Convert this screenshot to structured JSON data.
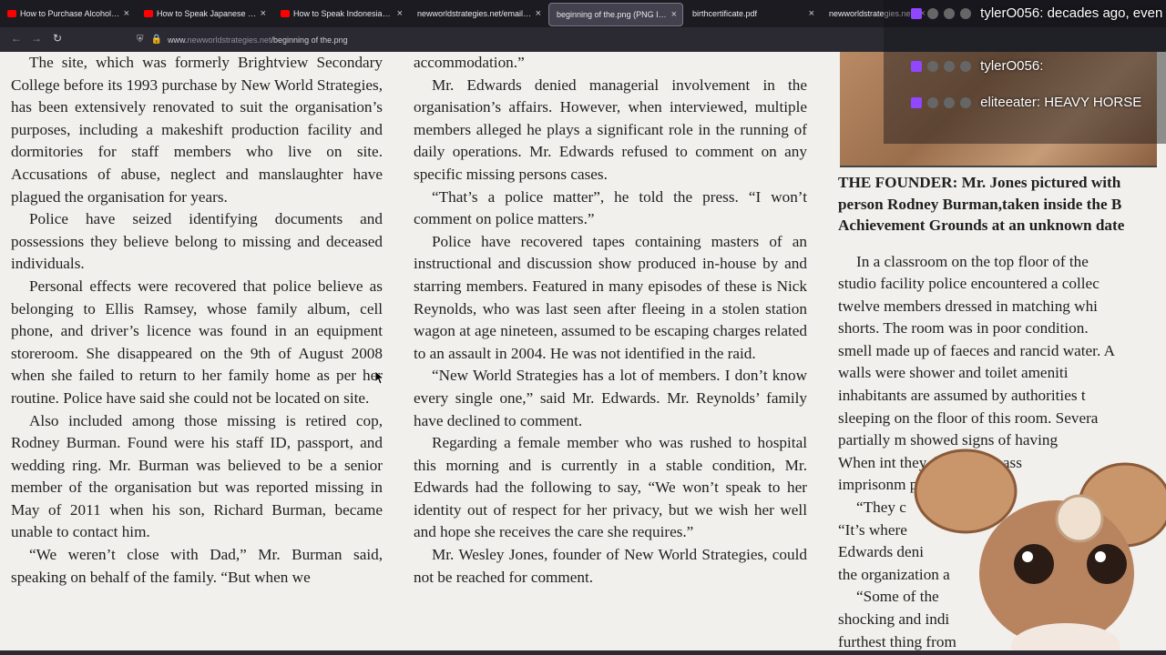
{
  "tabs": [
    {
      "label": "How to Purchase Alcohol if you",
      "icon": "youtube-icon",
      "active": false
    },
    {
      "label": "How to Speak Japanese - YouTu",
      "icon": "youtube-icon",
      "active": false
    },
    {
      "label": "How to Speak Indonesian - You",
      "icon": "youtube-icon",
      "active": false
    },
    {
      "label": "newworldstrategies.net/emails.htm",
      "icon": "",
      "active": false
    },
    {
      "label": "beginning of the.png (PNG Image, 2",
      "icon": "",
      "active": true
    },
    {
      "label": "birthcertificate.pdf",
      "icon": "",
      "active": false
    },
    {
      "label": "newworldstrategies.ne",
      "icon": "",
      "active": false
    }
  ],
  "address_bar": {
    "url_prefix": "www.",
    "url_domain": "newworldstrategies.net",
    "url_path": "/beginning of the.png"
  },
  "article": {
    "col1": [
      "The site, which was formerly Brightview Secondary College before its 1993 purchase by New World Strategies, has been extensively renovated to suit the organisation’s purposes, including a makeshift production facility and dormitories for staff members who live on site. Accusations of abuse, neglect and manslaughter have plagued the organisation for years.",
      "Police have seized identifying documents and possessions they believe belong to missing and deceased individuals.",
      "Personal effects were recovered that police believe as belonging to Ellis Ramsey, whose family album, cell phone, and driver’s licence was found in an equipment storeroom. She disappeared on the 9th of August 2008 when she failed to return to her family home as per her routine. Police have said she could not be located on site.",
      "Also included among those missing is retired cop, Rodney Burman. Found were his staff ID, passport, and wedding ring. Mr. Burman was believed to be a senior member of the organisation but was reported missing in May of 2011 when his son, Richard Burman, became unable to contact him.",
      "“We weren’t close with Dad,” Mr. Burman said, speaking on behalf of the family. “But when we"
    ],
    "col2": [
      "accommodation.”",
      "Mr. Edwards denied managerial involvement in the organisation’s affairs. However, when interviewed, multiple members alleged he plays a significant role in the running of daily operations. Mr. Edwards refused to comment on any specific missing persons cases.",
      "“That’s a police matter”, he told the press. “I won’t comment on police matters.”",
      "Police have recovered tapes containing masters of an instructional and discussion show produced in-house by and starring members. Featured in many episodes of these is Nick Reynolds, who was last seen after fleeing in a stolen station wagon at age nineteen, assumed to be escaping charges related to an assault in 2004. He was not identified in the raid.",
      "“New World Strategies has a lot of members. I don’t know every single one,” said Mr. Edwards. Mr. Reynolds’ family have declined to comment.",
      "Regarding a female member who was rushed to hospital this morning and is currently in a stable condition, Mr. Edwards had the following to say, “We won’t speak to her identity out of respect for her privacy, but we wish her well and hope she receives the care she requires.”",
      "Mr. Wesley Jones, founder of New World Strategies, could not be reached for comment."
    ],
    "col3_caption": [
      "THE FOUNDER: Mr. Jones pictured with",
      "person Rodney Burman,taken inside the B",
      "Achievement Grounds at an unknown date"
    ],
    "col3_lines": [
      "In a classroom on the top floor of the",
      "studio facility police encountered a collec",
      "twelve members dressed in matching whi",
      "shorts. The room was in poor condition.",
      "smell made up of faeces and rancid water. A",
      "walls were shower and toilet ameniti",
      "inhabitants are assumed by authorities t",
      "sleeping on the floor of this room. Severa",
      "partially m        showed signs of having",
      "When int         they denied any ass",
      "imprisonm                    place.",
      "“They c",
      "“It’s where",
      "Edwards deni",
      "the organization a",
      "“Some of the",
      "shocking and indi",
      "furthest thing from"
    ]
  },
  "chat": [
    {
      "user": "tylerO056",
      "message": "decades ago, even"
    },
    {
      "user": "tylerO056",
      "message": ""
    },
    {
      "user": "eliteeater",
      "message": "HEAVY HORSE"
    }
  ]
}
